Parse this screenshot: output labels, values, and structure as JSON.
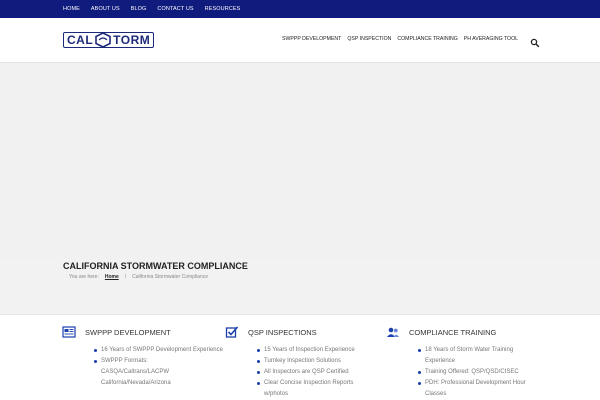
{
  "topnav": [
    "HOME",
    "ABOUT US",
    "BLOG",
    "CONTACT US",
    "RESOURCES"
  ],
  "logo": {
    "left": "CAL",
    "right": "TORM"
  },
  "mainnav": [
    "SWPPP DEVELOPMENT",
    "QSP INSPECTION",
    "COMPLIANCE TRAINING",
    "PH AVERAGING TOOL"
  ],
  "page": {
    "title": "CALIFORNIA STORMWATER COMPLIANCE",
    "breadcrumb": {
      "prefix": "You are here:",
      "home": "Home",
      "sep": "/",
      "current": "California Stormwater Compliance"
    }
  },
  "columns": [
    {
      "icon": "document-icon",
      "title": "SWPPP DEVELOPMENT",
      "items": [
        "16 Years of SWPPP Development Experience",
        "SWPPP Formats: CASQA/Caltrans/LACPW California/Nevada/Arizona"
      ]
    },
    {
      "icon": "checkbox-icon",
      "title": "QSP INSPECTIONS",
      "items": [
        "15 Years of Inspection Experience",
        "Turnkey Inspection Solutions",
        "All Inspectors are QSP Certified",
        "Clear Concise Inspection Reports w/photos"
      ]
    },
    {
      "icon": "users-icon",
      "title": "COMPLIANCE TRAINING",
      "items": [
        "18 Years of Storm Water Training Experience",
        "Training Offered: QSP/QSD/CISEC",
        "PDH: Professional Development Hour Classes"
      ]
    }
  ],
  "colors": {
    "topbar": "#101b7e",
    "accent": "#1c3fae",
    "logo": "#1d2a7a"
  }
}
